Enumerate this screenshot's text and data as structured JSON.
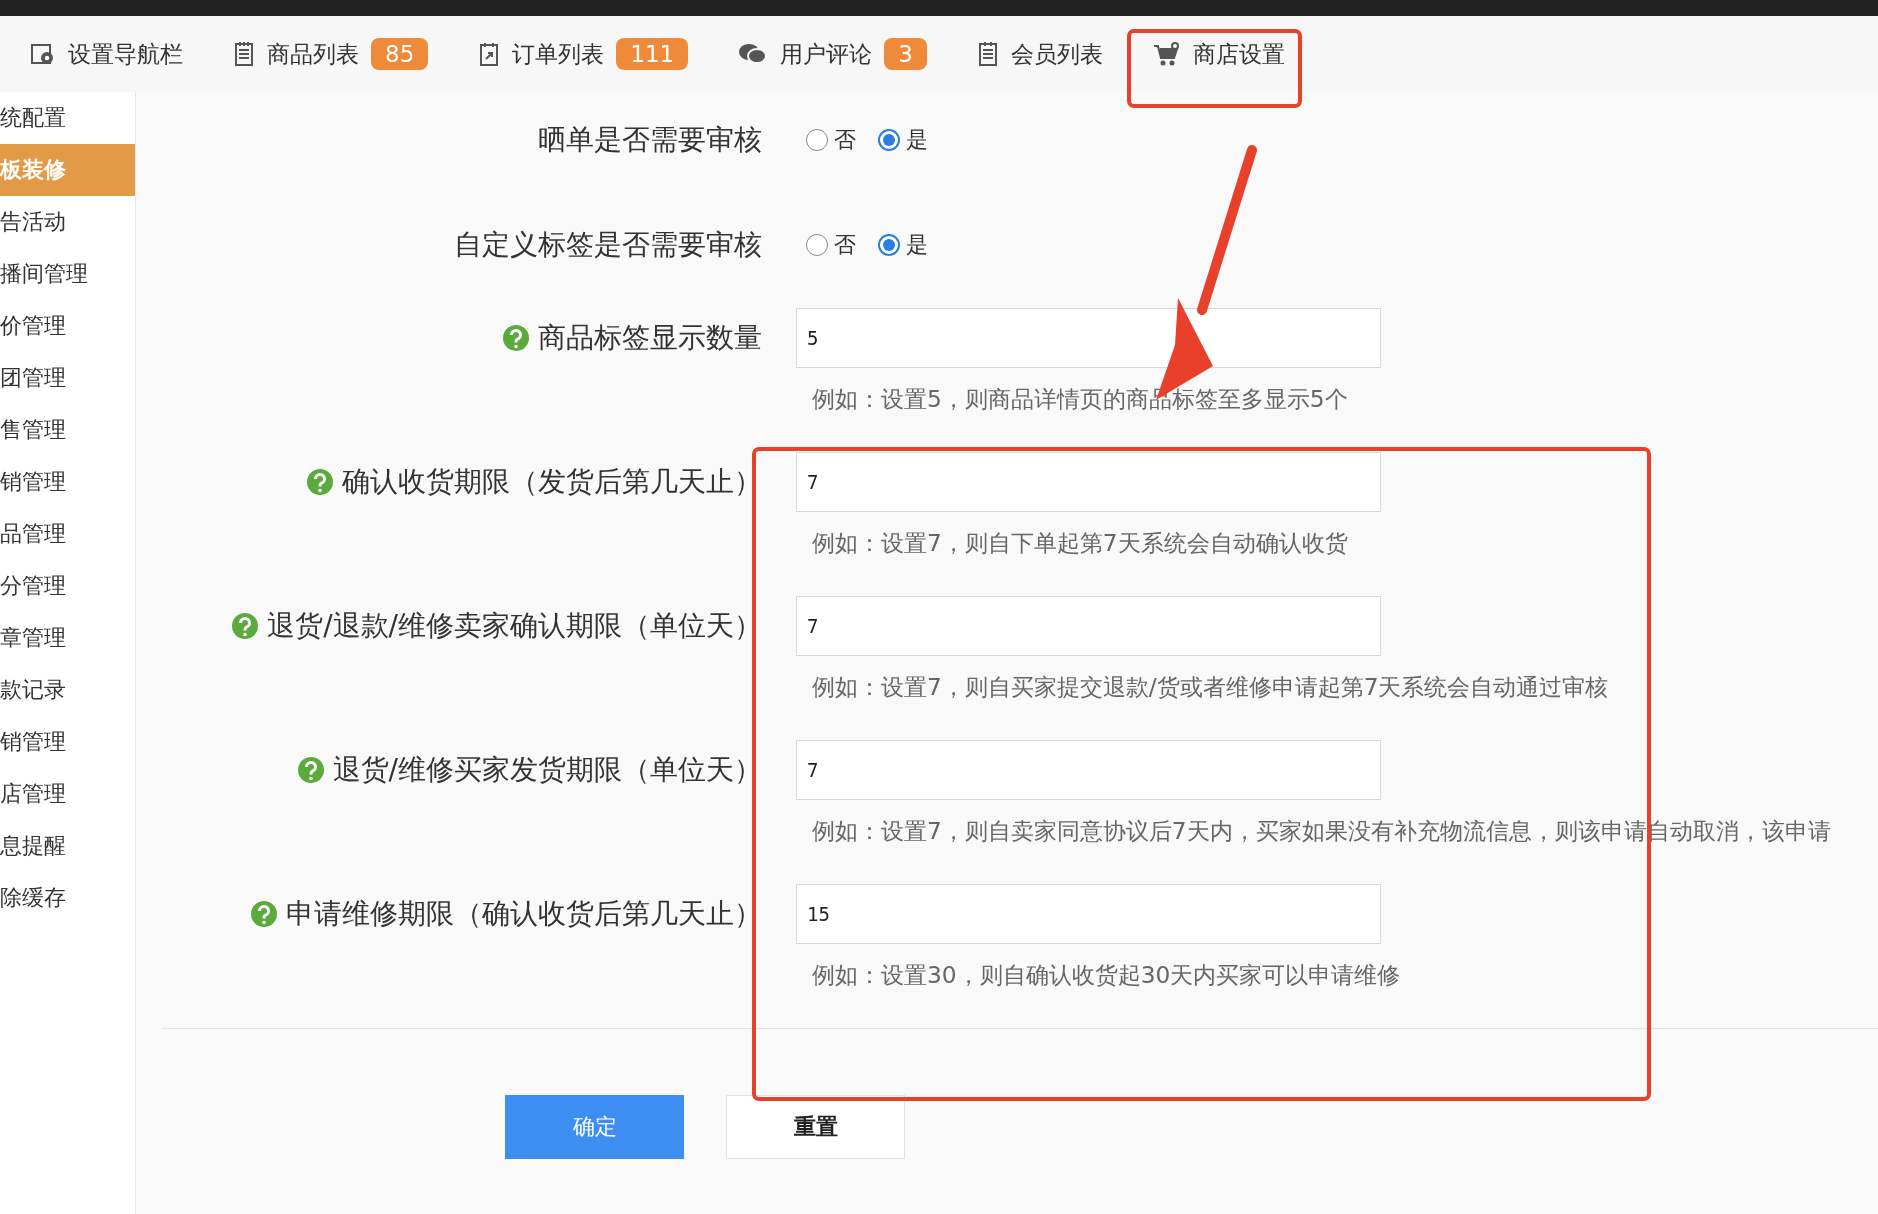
{
  "top_tabs": [
    {
      "label": "设置导航栏"
    },
    {
      "label": "商品列表",
      "badge": "85"
    },
    {
      "label": "订单列表",
      "badge": "111"
    },
    {
      "label": "用户评论",
      "badge": "3"
    },
    {
      "label": "会员列表"
    },
    {
      "label": "商店设置"
    }
  ],
  "sidebar": {
    "items": [
      {
        "label": "统配置",
        "selected": false
      },
      {
        "label": "板装修",
        "selected": true
      },
      {
        "label": "告活动",
        "selected": false
      },
      {
        "label": "播间管理",
        "selected": false
      },
      {
        "label": "价管理",
        "selected": false
      },
      {
        "label": "团管理",
        "selected": false
      },
      {
        "label": "售管理",
        "selected": false
      },
      {
        "label": "销管理",
        "selected": false
      },
      {
        "label": "品管理",
        "selected": false
      },
      {
        "label": "分管理",
        "selected": false
      },
      {
        "label": "章管理",
        "selected": false
      },
      {
        "label": "款记录",
        "selected": false
      },
      {
        "label": "销管理",
        "selected": false
      },
      {
        "label": "店管理",
        "selected": false
      },
      {
        "label": "息提醒",
        "selected": false
      },
      {
        "label": "除缓存",
        "selected": false
      }
    ]
  },
  "form": {
    "fields": [
      {
        "kind": "radio",
        "label": "晒单是否需要审核",
        "options": [
          {
            "label": "否",
            "selected": false
          },
          {
            "label": "是",
            "selected": true
          }
        ]
      },
      {
        "kind": "radio",
        "label": "自定义标签是否需要审核",
        "options": [
          {
            "label": "否",
            "selected": false
          },
          {
            "label": "是",
            "selected": true
          }
        ]
      },
      {
        "kind": "input",
        "label": "商品标签显示数量",
        "value": "5",
        "hint": "例如：设置5，则商品详情页的商品标签至多显示5个"
      },
      {
        "kind": "input",
        "label": "确认收货期限（发货后第几天止）",
        "value": "7",
        "hint": "例如：设置7，则自下单起第7天系统会自动确认收货"
      },
      {
        "kind": "input",
        "label": "退货/退款/维修卖家确认期限（单位天）",
        "value": "7",
        "hint": "例如：设置7，则自买家提交退款/货或者维修申请起第7天系统会自动通过审核"
      },
      {
        "kind": "input",
        "label": "退货/维修买家发货期限（单位天）",
        "value": "7",
        "hint": "例如：设置7，则自卖家同意协议后7天内，买家如果没有补充物流信息，则该申请自动取消，该申请"
      },
      {
        "kind": "input",
        "label": "申请维修期限（确认收货后第几天止）",
        "value": "15",
        "hint": "例如：设置30，则自确认收货起30天内买家可以申请维修"
      }
    ]
  },
  "buttons": [
    {
      "label": "确定",
      "kind": "primary"
    },
    {
      "label": "重置",
      "kind": "default"
    }
  ]
}
